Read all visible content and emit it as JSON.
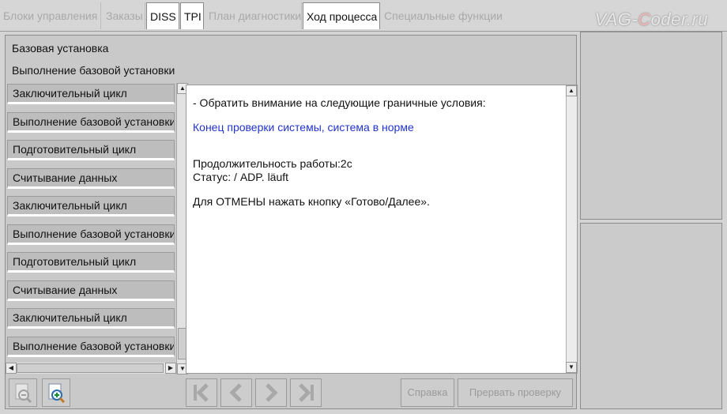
{
  "tabs": [
    {
      "label": "Блоки управления",
      "state": "disabled"
    },
    {
      "label": "Заказы",
      "state": "disabled"
    },
    {
      "label": "DISS",
      "state": "enabled"
    },
    {
      "label": "TPI",
      "state": "enabled"
    },
    {
      "label": "План диагностики",
      "state": "disabled"
    },
    {
      "label": "Ход процесса",
      "state": "active"
    },
    {
      "label": "Специальные функции",
      "state": "disabled"
    }
  ],
  "logo": {
    "prefix": "VAG-",
    "c": "C",
    "suffix": "oder.ru"
  },
  "main": {
    "title": "Базовая установка",
    "subtitle": "Выполнение базовой установки"
  },
  "steps": [
    "Заключительный цикл",
    "Выполнение базовой установки",
    "Подготовительный цикл",
    "Считывание данных",
    "Заключительный цикл",
    "Выполнение базовой установки",
    "Подготовительный цикл",
    "Считывание данных",
    "Заключительный цикл",
    "Выполнение базовой установки"
  ],
  "content": {
    "line1": "- Обратить внимание на следующие граничные условия:",
    "line2": "Конец проверки системы, система в норме",
    "line3": "Продолжительность работы:2с",
    "line4": "Статус: / ADP. läuft",
    "line5": "Для ОТМЕНЫ нажать кнопку «Готово/Далее»."
  },
  "toolbar": {
    "help_label": "Справка",
    "abort_label": "Прервать проверку"
  },
  "icons": {
    "zoom_out": "zoom-out-icon",
    "zoom_in": "zoom-in-icon",
    "first": "first-icon",
    "prev": "prev-icon",
    "next": "next-icon",
    "last": "last-icon"
  },
  "colors": {
    "accent_text": "#2233cc",
    "background": "#d4d4d4"
  }
}
